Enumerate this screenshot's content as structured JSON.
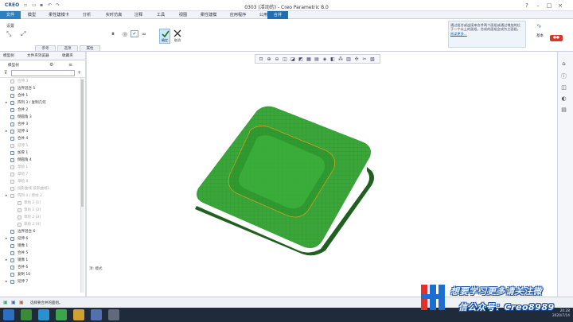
{
  "app": {
    "logo": "CREO",
    "window_title": "0303 (活动的) - Creo Parametric 8.0"
  },
  "menu": {
    "file": "文件",
    "items": [
      "模型",
      "柔性建模卡",
      "分析",
      "实时仿真",
      "注释",
      "工具",
      "视图",
      "柔性建模",
      "应用程序",
      "公用"
    ],
    "active": "合并"
  },
  "ribbon": {
    "group_label": "设置",
    "ok_label": "确定",
    "cancel_label": "取消",
    "subtabs": [
      "参考",
      "选项",
      "属性"
    ],
    "notice_text": "通过组合或连接来合并两个面组或通过增加的位于一个以上的面组，合成的面组会成为主面组。",
    "notice_link": "阅读更多...",
    "basic_label": "基本"
  },
  "left_panel": {
    "tabs": [
      "模型树",
      "文件夹浏览器",
      "收藏夹"
    ],
    "header": "模型树",
    "tree": [
      {
        "label": "拉伸 3",
        "dim": true
      },
      {
        "label": "边界混合 5",
        "dim": false
      },
      {
        "label": "合并 1",
        "dim": false
      },
      {
        "label": "阵列 3 / 复制几何",
        "dim": false,
        "expand": true
      },
      {
        "label": "合并 2",
        "dim": false
      },
      {
        "label": "倒圆角 3",
        "dim": false
      },
      {
        "label": "合并 3",
        "dim": false
      },
      {
        "label": "延伸 4",
        "dim": false,
        "expand": true
      },
      {
        "label": "合并 4",
        "dim": false
      },
      {
        "label": "延伸 5",
        "dim": true
      },
      {
        "label": "加厚 1",
        "dim": false
      },
      {
        "label": "倒圆角 4",
        "dim": false
      },
      {
        "label": "草绘 1",
        "dim": true
      },
      {
        "label": "草绘 7",
        "dim": true
      },
      {
        "label": "草绘 8",
        "dim": true
      },
      {
        "label": "投影曲线 投影曲线1",
        "dim": true
      },
      {
        "label": "阵列 4 / 草绘 2",
        "dim": true,
        "expand": true
      },
      {
        "label": "草绘 2 [1]",
        "dim": true,
        "indent": true
      },
      {
        "label": "草绘 2 [2]",
        "dim": true,
        "indent": true
      },
      {
        "label": "草绘 2 [3]",
        "dim": true,
        "indent": true
      },
      {
        "label": "草绘 2 [4]",
        "dim": true,
        "indent": true
      },
      {
        "label": "边界混合 6",
        "dim": false
      },
      {
        "label": "延伸 6",
        "dim": false,
        "expand": true
      },
      {
        "label": "镜像 1",
        "dim": false
      },
      {
        "label": "合并 5",
        "dim": false
      },
      {
        "label": "镜像 1",
        "dim": false,
        "expand": true
      },
      {
        "label": "合并 6",
        "dim": false
      },
      {
        "label": "复制 10",
        "dim": false
      },
      {
        "label": "延伸 7",
        "dim": false,
        "expand": true
      }
    ]
  },
  "viewport": {
    "label": "顶: 模式"
  },
  "status": {
    "message": "选择要合并的面组。"
  },
  "clock": {
    "time": "20:28",
    "date": "2020/7/14"
  },
  "watermark": {
    "line1": "想要学习更多请关注微",
    "line2": "信公众号：Creo8989"
  },
  "colors": {
    "accent": "#2c7fc0",
    "model_green": "#3aa63a",
    "model_dark": "#1f5f1f"
  }
}
